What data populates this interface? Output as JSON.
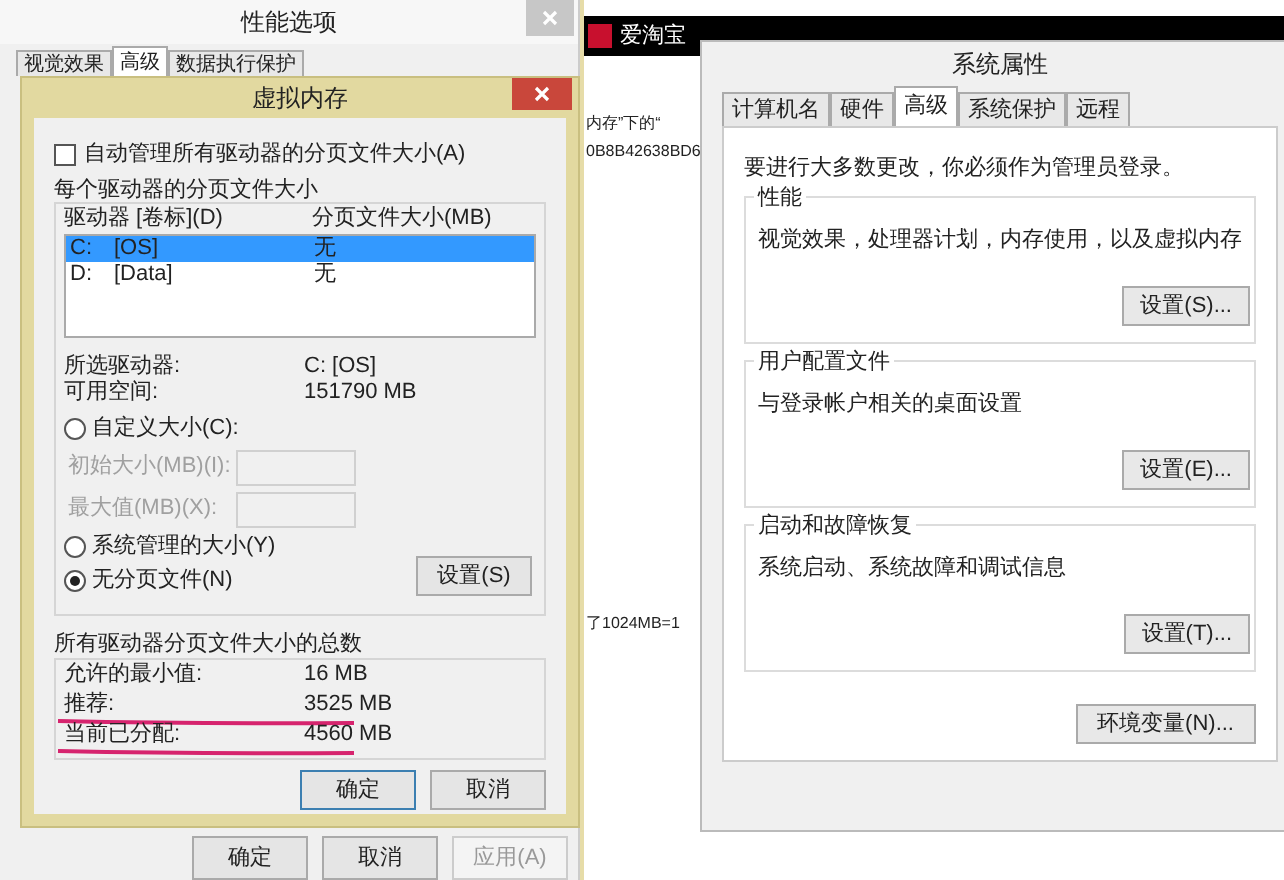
{
  "background_page": {
    "site_name": "爱淘宝",
    "text_fragments": [
      "内存”下的“",
      "0B8B42638BD6",
      "了1024MB=1"
    ]
  },
  "performance_options": {
    "title": "性能选项",
    "tabs": [
      {
        "label": "视觉效果",
        "selected": false
      },
      {
        "label": "高级",
        "selected": true
      },
      {
        "label": "数据执行保护",
        "selected": false
      }
    ],
    "buttons": [
      {
        "label": "确定",
        "disabled": false
      },
      {
        "label": "取消",
        "disabled": false
      },
      {
        "label": "应用(A)",
        "disabled": true
      }
    ]
  },
  "virtual_memory": {
    "title": "虚拟内存",
    "auto_manage": {
      "label": "自动管理所有驱动器的分页文件大小(A)",
      "checked": false
    },
    "drives_group": "每个驱动器的分页文件大小",
    "columns": [
      "驱动器 [卷标](D)",
      "分页文件大小(MB)"
    ],
    "drives": [
      {
        "letter": "C:",
        "volume": "[OS]",
        "size": "无",
        "selected": true
      },
      {
        "letter": "D:",
        "volume": "[Data]",
        "size": "无",
        "selected": false
      }
    ],
    "selected_drive": {
      "label": "所选驱动器:",
      "value": "C:  [OS]"
    },
    "free_space": {
      "label": "可用空间:",
      "value": "151790 MB"
    },
    "custom_size": {
      "label": "自定义大小(C):",
      "selected": false
    },
    "fields": [
      {
        "label": "初始大小(MB)(I):",
        "disabled": true
      },
      {
        "label": "最大值(MB)(X):",
        "disabled": true
      }
    ],
    "size_options": [
      {
        "label": "系统管理的大小(Y)",
        "selected": false
      },
      {
        "label": "无分页文件(N)",
        "selected": true
      }
    ],
    "set_button": "设置(S)",
    "totals_group": "所有驱动器分页文件大小的总数",
    "totals": [
      {
        "label": "允许的最小值:",
        "value": "16 MB",
        "underlined": false
      },
      {
        "label": "推荐:",
        "value": "3525 MB",
        "underlined": true
      },
      {
        "label": "当前已分配:",
        "value": "4560 MB",
        "underlined": true
      }
    ],
    "buttons": [
      {
        "label": "确定",
        "default": true
      },
      {
        "label": "取消",
        "default": false
      }
    ]
  },
  "system_properties": {
    "title": "系统属性",
    "tabs": [
      {
        "label": "计算机名",
        "selected": false
      },
      {
        "label": "硬件",
        "selected": false
      },
      {
        "label": "高级",
        "selected": true
      },
      {
        "label": "系统保护",
        "selected": false
      },
      {
        "label": "远程",
        "selected": false
      }
    ],
    "notice": "要进行大多数更改，你必须作为管理员登录。",
    "groups": [
      {
        "title": "性能",
        "description": "视觉效果，处理器计划，内存使用，以及虚拟内存",
        "button": "设置(S)..."
      },
      {
        "title": "用户配置文件",
        "description": "与登录帐户相关的桌面设置",
        "button": "设置(E)..."
      },
      {
        "title": "启动和故障恢复",
        "description": "系统启动、系统故障和调试信息",
        "button": "设置(T)..."
      }
    ],
    "env_button": "环境变量(N)..."
  }
}
